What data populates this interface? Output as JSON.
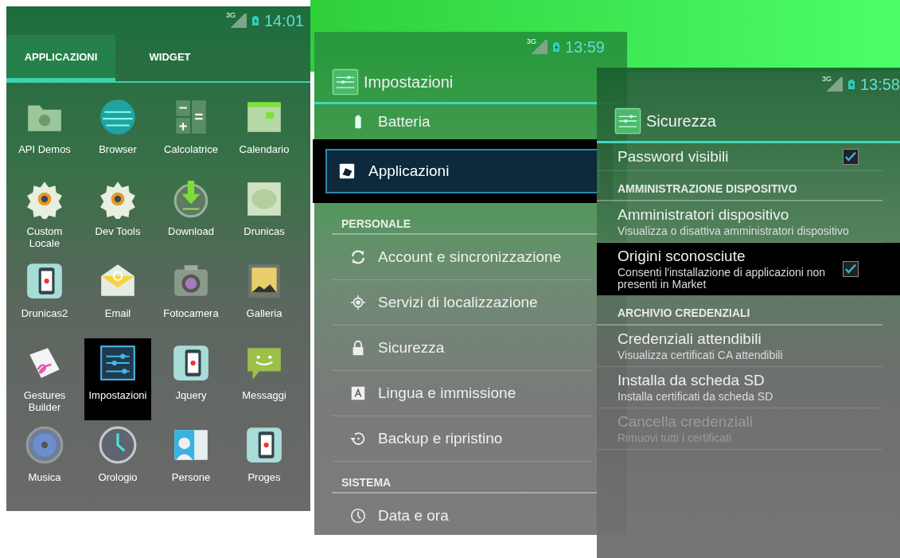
{
  "screens": [
    {
      "kind": "app_drawer",
      "status_bar": {
        "network": "3G",
        "time": "14:01"
      },
      "tabs": [
        {
          "label": "APPLICAZIONI",
          "selected": true
        },
        {
          "label": "WIDGET",
          "selected": false
        }
      ],
      "apps": [
        {
          "label": "API Demos",
          "selected": false
        },
        {
          "label": "Browser",
          "selected": false
        },
        {
          "label": "Calcolatrice",
          "selected": false
        },
        {
          "label": "Calendario",
          "selected": false
        },
        {
          "label": "Custom Locale",
          "selected": false
        },
        {
          "label": "Dev Tools",
          "selected": false
        },
        {
          "label": "Download",
          "selected": false
        },
        {
          "label": "Drunicas",
          "selected": false
        },
        {
          "label": "Drunicas2",
          "selected": false
        },
        {
          "label": "Email",
          "selected": false
        },
        {
          "label": "Fotocamera",
          "selected": false
        },
        {
          "label": "Galleria",
          "selected": false
        },
        {
          "label": "Gestures Builder",
          "selected": false
        },
        {
          "label": "Impostazioni",
          "selected": true
        },
        {
          "label": "Jquery",
          "selected": false
        },
        {
          "label": "Messaggi",
          "selected": false
        },
        {
          "label": "Musica",
          "selected": false
        },
        {
          "label": "Orologio",
          "selected": false
        },
        {
          "label": "Persone",
          "selected": false
        },
        {
          "label": "Proges",
          "selected": false
        }
      ]
    },
    {
      "kind": "settings",
      "status_bar": {
        "network": "3G",
        "time": "13:59"
      },
      "title": "Impostazioni",
      "rows": [
        {
          "kind": "item",
          "label": "Batteria",
          "selected": false
        },
        {
          "kind": "item",
          "label": "Applicazioni",
          "selected": true
        },
        {
          "kind": "header",
          "label": "PERSONALE"
        },
        {
          "kind": "item",
          "label": "Account e sincronizzazione",
          "selected": false
        },
        {
          "kind": "item",
          "label": "Servizi di localizzazione",
          "selected": false
        },
        {
          "kind": "item",
          "label": "Sicurezza",
          "selected": false
        },
        {
          "kind": "item",
          "label": "Lingua e immissione",
          "selected": false
        },
        {
          "kind": "item",
          "label": "Backup e ripristino",
          "selected": false
        },
        {
          "kind": "header",
          "label": "SISTEMA"
        },
        {
          "kind": "item",
          "label": "Data e ora",
          "selected": false
        }
      ]
    },
    {
      "kind": "security",
      "status_bar": {
        "network": "3G",
        "time": "13:58"
      },
      "title": "Sicurezza",
      "rows": [
        {
          "kind": "check",
          "title": "Password visibili",
          "checked": true,
          "selected": false
        },
        {
          "kind": "header",
          "label": "AMMINISTRAZIONE DISPOSITIVO"
        },
        {
          "kind": "pref",
          "title": "Amministratori dispositivo",
          "summary": "Visualizza o disattiva amministratori dispositivo",
          "disabled": false
        },
        {
          "kind": "check",
          "title": "Origini sconosciute",
          "summary": "Consenti l'installazione di applicazioni non presenti in Market",
          "checked": true,
          "selected": true
        },
        {
          "kind": "header",
          "label": "ARCHIVIO CREDENZIALI"
        },
        {
          "kind": "pref",
          "title": "Credenziali attendibili",
          "summary": "Visualizza certificati CA attendibili",
          "disabled": false
        },
        {
          "kind": "pref",
          "title": "Installa da scheda SD",
          "summary": "Installa certificati da scheda SD",
          "disabled": false
        },
        {
          "kind": "pref",
          "title": "Cancella credenziali",
          "summary": "Rimuovi tutti i certificati",
          "disabled": true
        }
      ]
    }
  ]
}
